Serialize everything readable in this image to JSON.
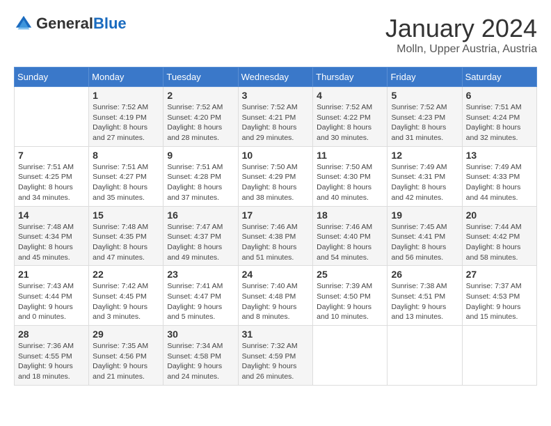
{
  "header": {
    "logo_general": "General",
    "logo_blue": "Blue",
    "title": "January 2024",
    "subtitle": "Molln, Upper Austria, Austria"
  },
  "days_of_week": [
    "Sunday",
    "Monday",
    "Tuesday",
    "Wednesday",
    "Thursday",
    "Friday",
    "Saturday"
  ],
  "weeks": [
    [
      {
        "day": "",
        "sunrise": "",
        "sunset": "",
        "daylight": ""
      },
      {
        "day": "1",
        "sunrise": "Sunrise: 7:52 AM",
        "sunset": "Sunset: 4:19 PM",
        "daylight": "Daylight: 8 hours and 27 minutes."
      },
      {
        "day": "2",
        "sunrise": "Sunrise: 7:52 AM",
        "sunset": "Sunset: 4:20 PM",
        "daylight": "Daylight: 8 hours and 28 minutes."
      },
      {
        "day": "3",
        "sunrise": "Sunrise: 7:52 AM",
        "sunset": "Sunset: 4:21 PM",
        "daylight": "Daylight: 8 hours and 29 minutes."
      },
      {
        "day": "4",
        "sunrise": "Sunrise: 7:52 AM",
        "sunset": "Sunset: 4:22 PM",
        "daylight": "Daylight: 8 hours and 30 minutes."
      },
      {
        "day": "5",
        "sunrise": "Sunrise: 7:52 AM",
        "sunset": "Sunset: 4:23 PM",
        "daylight": "Daylight: 8 hours and 31 minutes."
      },
      {
        "day": "6",
        "sunrise": "Sunrise: 7:51 AM",
        "sunset": "Sunset: 4:24 PM",
        "daylight": "Daylight: 8 hours and 32 minutes."
      }
    ],
    [
      {
        "day": "7",
        "sunrise": "Sunrise: 7:51 AM",
        "sunset": "Sunset: 4:25 PM",
        "daylight": "Daylight: 8 hours and 34 minutes."
      },
      {
        "day": "8",
        "sunrise": "Sunrise: 7:51 AM",
        "sunset": "Sunset: 4:27 PM",
        "daylight": "Daylight: 8 hours and 35 minutes."
      },
      {
        "day": "9",
        "sunrise": "Sunrise: 7:51 AM",
        "sunset": "Sunset: 4:28 PM",
        "daylight": "Daylight: 8 hours and 37 minutes."
      },
      {
        "day": "10",
        "sunrise": "Sunrise: 7:50 AM",
        "sunset": "Sunset: 4:29 PM",
        "daylight": "Daylight: 8 hours and 38 minutes."
      },
      {
        "day": "11",
        "sunrise": "Sunrise: 7:50 AM",
        "sunset": "Sunset: 4:30 PM",
        "daylight": "Daylight: 8 hours and 40 minutes."
      },
      {
        "day": "12",
        "sunrise": "Sunrise: 7:49 AM",
        "sunset": "Sunset: 4:31 PM",
        "daylight": "Daylight: 8 hours and 42 minutes."
      },
      {
        "day": "13",
        "sunrise": "Sunrise: 7:49 AM",
        "sunset": "Sunset: 4:33 PM",
        "daylight": "Daylight: 8 hours and 44 minutes."
      }
    ],
    [
      {
        "day": "14",
        "sunrise": "Sunrise: 7:48 AM",
        "sunset": "Sunset: 4:34 PM",
        "daylight": "Daylight: 8 hours and 45 minutes."
      },
      {
        "day": "15",
        "sunrise": "Sunrise: 7:48 AM",
        "sunset": "Sunset: 4:35 PM",
        "daylight": "Daylight: 8 hours and 47 minutes."
      },
      {
        "day": "16",
        "sunrise": "Sunrise: 7:47 AM",
        "sunset": "Sunset: 4:37 PM",
        "daylight": "Daylight: 8 hours and 49 minutes."
      },
      {
        "day": "17",
        "sunrise": "Sunrise: 7:46 AM",
        "sunset": "Sunset: 4:38 PM",
        "daylight": "Daylight: 8 hours and 51 minutes."
      },
      {
        "day": "18",
        "sunrise": "Sunrise: 7:46 AM",
        "sunset": "Sunset: 4:40 PM",
        "daylight": "Daylight: 8 hours and 54 minutes."
      },
      {
        "day": "19",
        "sunrise": "Sunrise: 7:45 AM",
        "sunset": "Sunset: 4:41 PM",
        "daylight": "Daylight: 8 hours and 56 minutes."
      },
      {
        "day": "20",
        "sunrise": "Sunrise: 7:44 AM",
        "sunset": "Sunset: 4:42 PM",
        "daylight": "Daylight: 8 hours and 58 minutes."
      }
    ],
    [
      {
        "day": "21",
        "sunrise": "Sunrise: 7:43 AM",
        "sunset": "Sunset: 4:44 PM",
        "daylight": "Daylight: 9 hours and 0 minutes."
      },
      {
        "day": "22",
        "sunrise": "Sunrise: 7:42 AM",
        "sunset": "Sunset: 4:45 PM",
        "daylight": "Daylight: 9 hours and 3 minutes."
      },
      {
        "day": "23",
        "sunrise": "Sunrise: 7:41 AM",
        "sunset": "Sunset: 4:47 PM",
        "daylight": "Daylight: 9 hours and 5 minutes."
      },
      {
        "day": "24",
        "sunrise": "Sunrise: 7:40 AM",
        "sunset": "Sunset: 4:48 PM",
        "daylight": "Daylight: 9 hours and 8 minutes."
      },
      {
        "day": "25",
        "sunrise": "Sunrise: 7:39 AM",
        "sunset": "Sunset: 4:50 PM",
        "daylight": "Daylight: 9 hours and 10 minutes."
      },
      {
        "day": "26",
        "sunrise": "Sunrise: 7:38 AM",
        "sunset": "Sunset: 4:51 PM",
        "daylight": "Daylight: 9 hours and 13 minutes."
      },
      {
        "day": "27",
        "sunrise": "Sunrise: 7:37 AM",
        "sunset": "Sunset: 4:53 PM",
        "daylight": "Daylight: 9 hours and 15 minutes."
      }
    ],
    [
      {
        "day": "28",
        "sunrise": "Sunrise: 7:36 AM",
        "sunset": "Sunset: 4:55 PM",
        "daylight": "Daylight: 9 hours and 18 minutes."
      },
      {
        "day": "29",
        "sunrise": "Sunrise: 7:35 AM",
        "sunset": "Sunset: 4:56 PM",
        "daylight": "Daylight: 9 hours and 21 minutes."
      },
      {
        "day": "30",
        "sunrise": "Sunrise: 7:34 AM",
        "sunset": "Sunset: 4:58 PM",
        "daylight": "Daylight: 9 hours and 24 minutes."
      },
      {
        "day": "31",
        "sunrise": "Sunrise: 7:32 AM",
        "sunset": "Sunset: 4:59 PM",
        "daylight": "Daylight: 9 hours and 26 minutes."
      },
      {
        "day": "",
        "sunrise": "",
        "sunset": "",
        "daylight": ""
      },
      {
        "day": "",
        "sunrise": "",
        "sunset": "",
        "daylight": ""
      },
      {
        "day": "",
        "sunrise": "",
        "sunset": "",
        "daylight": ""
      }
    ]
  ]
}
